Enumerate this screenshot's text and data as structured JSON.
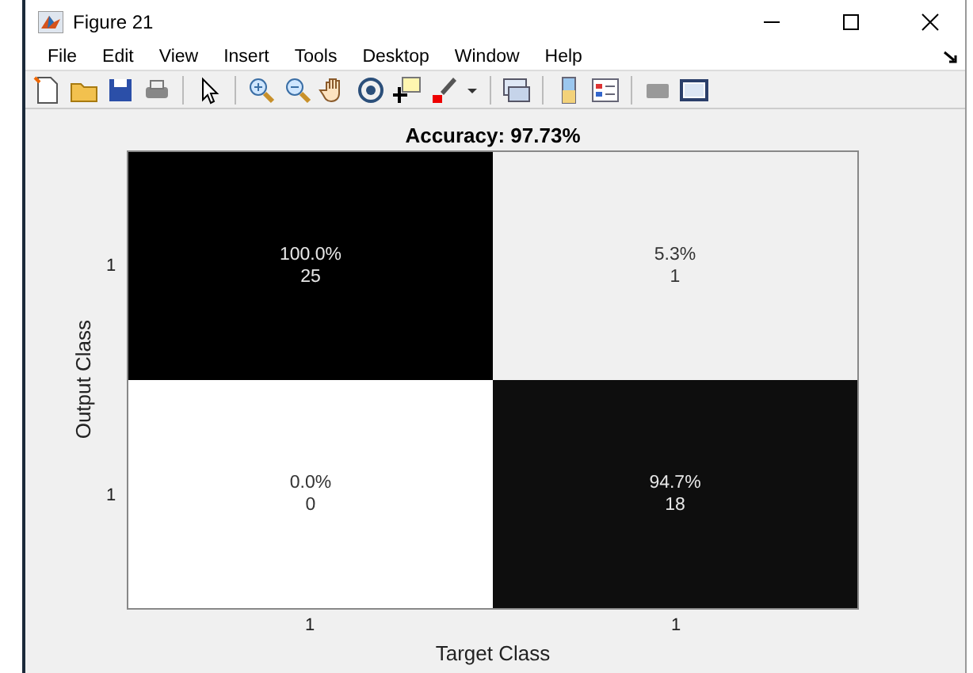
{
  "window": {
    "title": "Figure 21"
  },
  "menu": [
    "File",
    "Edit",
    "View",
    "Insert",
    "Tools",
    "Desktop",
    "Window",
    "Help"
  ],
  "plot": {
    "title": "Accuracy: 97.73%",
    "ylabel": "Output Class",
    "xlabel": "Target Class",
    "row_labels": [
      "1",
      "1"
    ],
    "column_labels": [
      "1",
      "1"
    ],
    "cells": [
      {
        "percent": "100.0%",
        "count": "25",
        "color": "#000000"
      },
      {
        "percent": "5.3%",
        "count": "1",
        "color": "#f0f0f0"
      },
      {
        "percent": "0.0%",
        "count": "0",
        "color": "#ffffff"
      },
      {
        "percent": "94.7%",
        "count": "18",
        "color": "#0e0e0e"
      }
    ]
  }
}
